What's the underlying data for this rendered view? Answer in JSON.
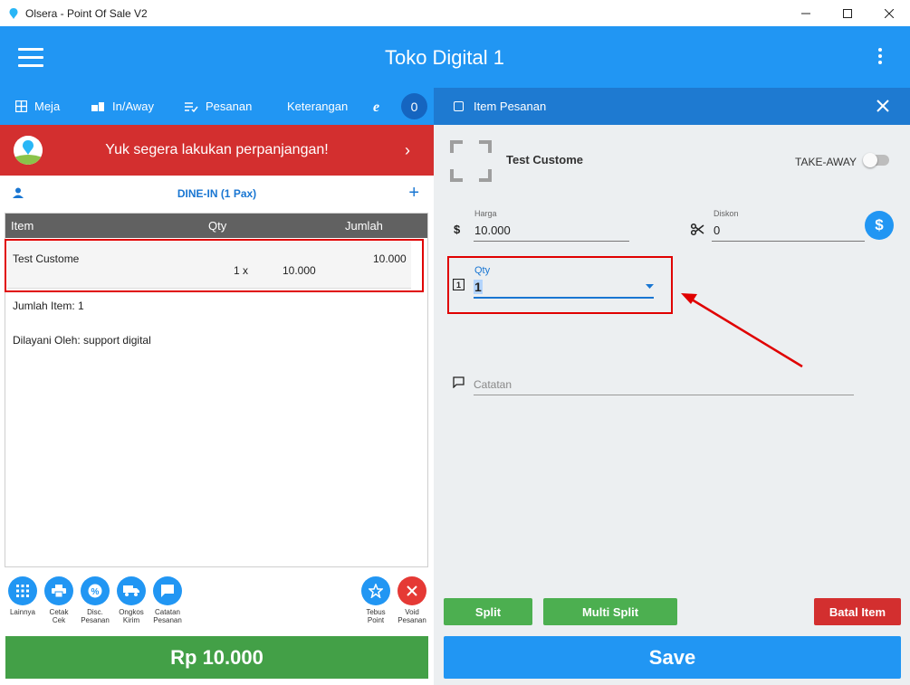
{
  "window": {
    "title": "Olsera - Point Of Sale V2"
  },
  "appbar": {
    "store_name": "Toko Digital 1"
  },
  "toolbar": {
    "meja": "Meja",
    "in_away": "In/Away",
    "pesanan": "Pesanan",
    "keterangan": "Keterangan",
    "badge": "0"
  },
  "banner": {
    "text": "Yuk segera lakukan perpanjangan!"
  },
  "order": {
    "mode": "DINE-IN (1 Pax)",
    "headers": {
      "item": "Item",
      "qty": "Qty",
      "jumlah": "Jumlah"
    },
    "rows": [
      {
        "name": "Test Custome",
        "qty": "1 x",
        "price": "10.000",
        "total": "10.000"
      }
    ],
    "jumlah_item": "Jumlah Item: 1",
    "dilayani": "Dilayani Oleh: support digital"
  },
  "actions": {
    "lainnya": "Lainnya",
    "cetak_1": "Cetak",
    "cetak_2": "Cek",
    "disc_1": "Disc.",
    "disc_2": "Pesanan",
    "ongkos_1": "Ongkos",
    "ongkos_2": "Kirim",
    "catatan_1": "Catatan",
    "catatan_2": "Pesanan",
    "tebus_1": "Tebus",
    "tebus_2": "Point",
    "void_1": "Void",
    "void_2": "Pesanan"
  },
  "total": "Rp 10.000",
  "item_panel": {
    "header": "Item Pesanan",
    "item_name": "Test Custome",
    "take_away": "TAKE-AWAY",
    "harga_label": "Harga",
    "harga_value": "10.000",
    "diskon_label": "Diskon",
    "diskon_value": "0",
    "qty_label": "Qty",
    "qty_value": "1",
    "catatan_placeholder": "Catatan",
    "split": "Split",
    "multi_split": "Multi Split",
    "batal_item": "Batal Item",
    "save": "Save"
  },
  "colors": {
    "primary": "#2196f3",
    "banner_red": "#d32f2f",
    "green": "#43a047",
    "batal_red": "#d32f2f",
    "annotation_red": "#e00000"
  }
}
